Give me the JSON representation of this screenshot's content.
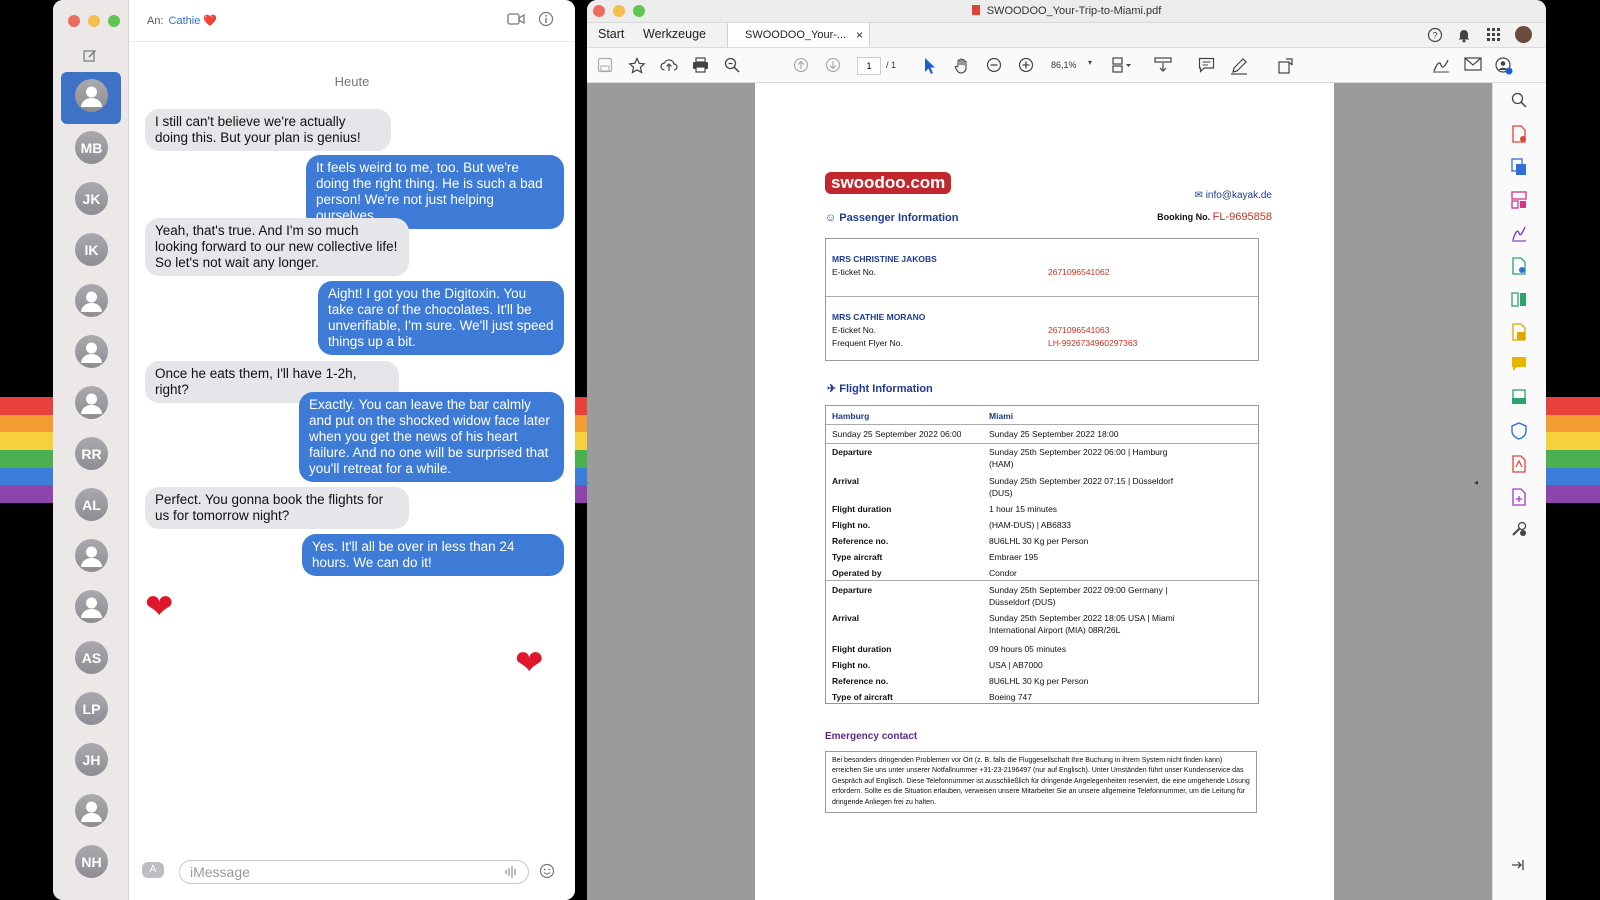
{
  "rainbow_colors": [
    "#e8413b",
    "#f39c32",
    "#f6d13d",
    "#4caf50",
    "#3b7dd8",
    "#8e44ad"
  ],
  "messages": {
    "to_label": "An:",
    "to_name": "Cathie ❤️",
    "date_label": "Heute",
    "contacts": [
      {
        "initials": ""
      },
      {
        "initials": "MB"
      },
      {
        "initials": "JK"
      },
      {
        "initials": "IK"
      },
      {
        "initials": ""
      },
      {
        "initials": ""
      },
      {
        "initials": ""
      },
      {
        "initials": "RR"
      },
      {
        "initials": "AL"
      },
      {
        "initials": ""
      },
      {
        "initials": ""
      },
      {
        "initials": "AS"
      },
      {
        "initials": "LP"
      },
      {
        "initials": "JH"
      },
      {
        "initials": ""
      },
      {
        "initials": "NH"
      }
    ],
    "thread": [
      {
        "dir": "in",
        "text": "I still can't believe we're actually doing this. But your plan is genius!"
      },
      {
        "dir": "out",
        "text": "It feels weird to me, too. But we're doing the right thing. He is such a bad person! We're not just helping ourselves..."
      },
      {
        "dir": "in",
        "text": "Yeah, that's true. And I'm so much looking forward to our new collective life! So let's not wait any longer."
      },
      {
        "dir": "out",
        "text": "Aight! I got you the Digitoxin. You take care of the chocolates. It'll be unverifiable, I'm sure. We'll just speed things up a bit."
      },
      {
        "dir": "in",
        "text": "Once he eats them, I'll have 1-2h, right?"
      },
      {
        "dir": "out",
        "text": "Exactly. You can leave the bar calmly and put on the shocked widow face later when you get the news of his heart failure. And no one will be surprised that you'll retreat for a while."
      },
      {
        "dir": "in",
        "text": "Perfect. You gonna book the flights for us for tomorrow night?"
      },
      {
        "dir": "out",
        "text": "Yes. It'll all be over in less than 24 hours. We can do it!"
      }
    ],
    "heart": "❤",
    "input_placeholder": "iMessage"
  },
  "pdf": {
    "window_title": "SWOODOO_Your-Trip-to-Miami.pdf",
    "tabs": {
      "start": "Start",
      "tools": "Werkzeuge",
      "doc": "SWOODOO_Your-...",
      "close": "×"
    },
    "page_current": "1",
    "page_total": "/ 1",
    "zoom": "86,1%",
    "doc": {
      "logo": "swoodoo.com",
      "email": "info@kayak.de",
      "passenger_title": "Passenger Information",
      "booking_label": "Booking No.",
      "booking_no": "FL-9695858",
      "pass1_name": "MRS CHRISTINE JAKOBS",
      "pass1_eticket_label": "E-ticket No.",
      "pass1_eticket": "2671096541062",
      "pass2_name": "MRS CATHIE MORANO",
      "pass2_eticket_label": "E-ticket No.",
      "pass2_eticket": "2671096541063",
      "pass2_ff_label": "Frequent Flyer No.",
      "pass2_ff": "LH-9926734960297363",
      "flight_title": "Flight Information",
      "from_city": "Hamburg",
      "to_city": "Miami",
      "from_date": "Sunday 25 September 2022 06:00",
      "to_date": "Sunday 25 September 2022 18:00",
      "rows": [
        {
          "label": "Departure",
          "value": "Sunday 25th September 2022 06:00 | Hamburg (HAM)"
        },
        {
          "label": "Arrival",
          "value": "Sunday 25th September 2022 07:15 | Düsseldorf (DUS)"
        },
        {
          "label": "Flight duration",
          "value": "1 hour 15 minutes"
        },
        {
          "label": "Flight no.",
          "value": "(HAM-DUS) | AB6833"
        },
        {
          "label": "Reference no.",
          "value": "8U6LHL 30 Kg per Person"
        },
        {
          "label": "Type aircraft",
          "value": "Embraer 195"
        },
        {
          "label": "Operated by",
          "value": "Condor"
        },
        {
          "label": "Departure",
          "value": "Sunday 25th September 2022 09:00 Germany | Düsseldorf (DUS)"
        },
        {
          "label": "Arrival",
          "value": "Sunday 25th September 2022 18:05 USA | Miami International Airport (MIA) 08R/26L"
        },
        {
          "label": "Flight duration",
          "value": "09 hours 05 minutes"
        },
        {
          "label": "Flight no.",
          "value": "USA | AB7000"
        },
        {
          "label": "Reference no.",
          "value": "8U6LHL 30 Kg per Person"
        },
        {
          "label": "Type of aircraft",
          "value": "Boeing 747"
        }
      ],
      "emergency_title": "Emergency contact",
      "emergency_text": "Bei besonders dringenden Problemen vor Ort (z. B. falls die Fluggesellschaft Ihre Buchung in ihrem System nicht finden kann) erreichen Sie uns unter unserer Notfallnummer +31-23-2196497 (nur auf Englisch). Unter Umständen führt unser Kundenservice das Gespräch auf Englisch. Diese Telefonnummer ist ausschließlich für dringende Angelegenheiten reserviert, die eine umgehende Lösung erfordern. Sollte es die Situation erlauben, verweisen unsere Mitarbeiter Sie an unsere allgemeine Telefonnummer, um die Leitung für dringende Anliegen frei zu halten."
    }
  }
}
